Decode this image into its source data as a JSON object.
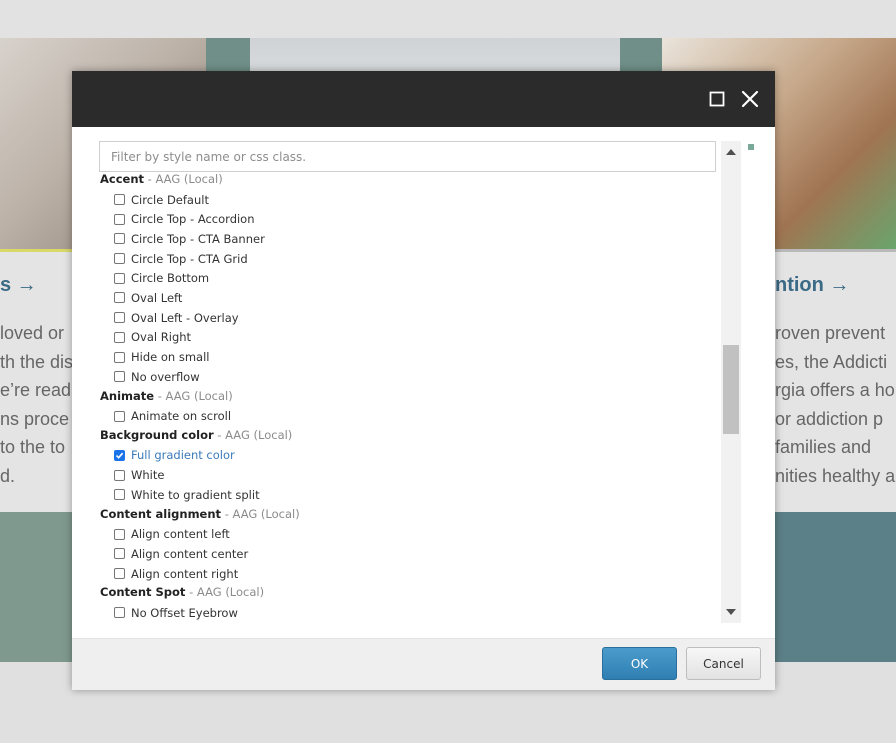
{
  "background": {
    "left_heading": "s →",
    "right_heading": "ntion →",
    "left_text": [
      "loved or",
      "th the dis",
      "e’re read",
      "ns proce",
      "to the to",
      "d."
    ],
    "right_text": [
      "roven prevent",
      "es, the Addicti",
      "rgia offers a ho",
      "or addiction p",
      "families and",
      "nities healthy a"
    ]
  },
  "dialog": {
    "filter_placeholder": "Filter by style name or css class.",
    "groups": [
      {
        "name": "Accent",
        "source": " - AAG (Local)",
        "items": [
          {
            "label": "Circle Default",
            "checked": false
          },
          {
            "label": "Circle Top - Accordion",
            "checked": false
          },
          {
            "label": "Circle Top - CTA Banner",
            "checked": false
          },
          {
            "label": "Circle Top - CTA Grid",
            "checked": false
          },
          {
            "label": "Circle Bottom",
            "checked": false
          },
          {
            "label": "Oval Left",
            "checked": false
          },
          {
            "label": "Oval Left - Overlay",
            "checked": false
          },
          {
            "label": "Oval Right",
            "checked": false
          },
          {
            "label": "Hide on small",
            "checked": false
          },
          {
            "label": "No overflow",
            "checked": false
          }
        ]
      },
      {
        "name": "Animate",
        "source": " - AAG (Local)",
        "items": [
          {
            "label": "Animate on scroll",
            "checked": false
          }
        ]
      },
      {
        "name": "Background color",
        "source": " - AAG (Local)",
        "items": [
          {
            "label": "Full gradient color",
            "checked": true
          },
          {
            "label": "White",
            "checked": false
          },
          {
            "label": "White to gradient split",
            "checked": false
          }
        ]
      },
      {
        "name": "Content alignment",
        "source": " - AAG (Local)",
        "items": [
          {
            "label": "Align content left",
            "checked": false
          },
          {
            "label": "Align content center",
            "checked": false
          },
          {
            "label": "Align content right",
            "checked": false
          }
        ]
      },
      {
        "name": "Content Spot",
        "source": " - AAG (Local)",
        "items": [
          {
            "label": "No Offset Eyebrow",
            "checked": false
          }
        ]
      }
    ],
    "ok_label": "OK",
    "cancel_label": "Cancel"
  },
  "colors": {
    "header_bg": "#2b2b2b",
    "ok_button": "#2f7fb3",
    "checked_label": "#3b7ab8",
    "heading_blue": "#3b6a86"
  }
}
